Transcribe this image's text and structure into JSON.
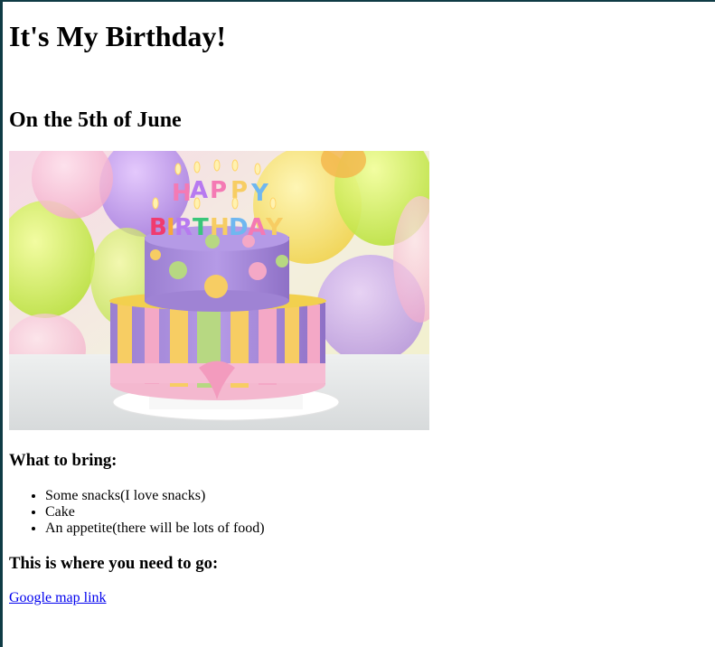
{
  "page": {
    "title": "It's My Birthday!",
    "subtitle": "On the 5th of June"
  },
  "image": {
    "description_icon": "birthday-cake-image",
    "candle_text_top": "HAPPY",
    "candle_text_bottom": "BIRTHDAY"
  },
  "bring": {
    "heading": "What to bring:",
    "items": [
      "Some snacks(I love snacks)",
      "Cake",
      "An appetite(there will be lots of food)"
    ]
  },
  "location": {
    "heading": "This is where you need to go:",
    "link_text": "Google map link"
  },
  "colors": {
    "link": "#0000ee",
    "window_border": "#0f3b45"
  }
}
